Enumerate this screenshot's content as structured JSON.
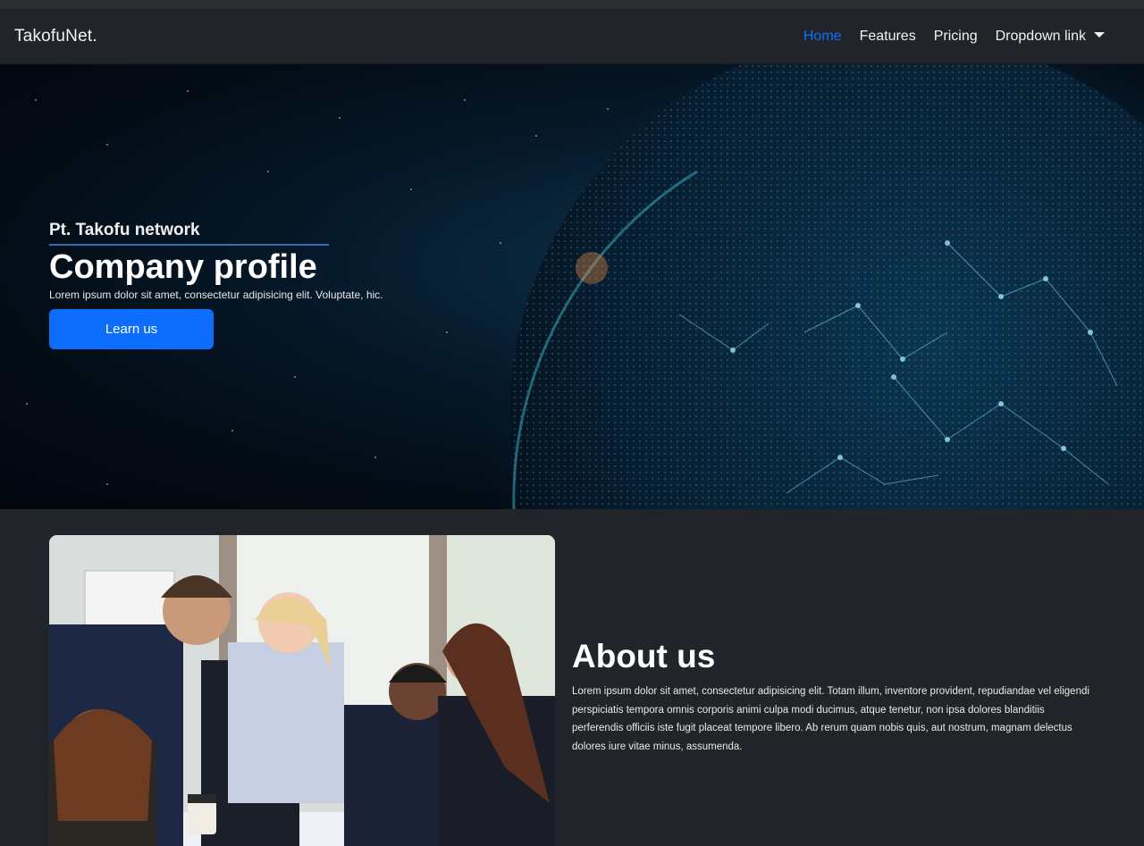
{
  "navbar": {
    "brand": "TakofuNet.",
    "links": [
      {
        "label": "Home",
        "active": true
      },
      {
        "label": "Features",
        "active": false
      },
      {
        "label": "Pricing",
        "active": false
      },
      {
        "label": "Dropdown link",
        "active": false,
        "dropdown": true
      }
    ]
  },
  "hero": {
    "subtitle": "Pt. Takofu network",
    "title": "Company profile",
    "text": "Lorem ipsum dolor sit amet, consectetur adipisicing elit. Voluptate, hic.",
    "button_label": "Learn us",
    "background": "earth-network-globe-image"
  },
  "about": {
    "title": "About us",
    "body": "Lorem ipsum dolor sit amet, consectetur adipisicing elit. Totam illum, inventore provident, repudiandae vel eligendi perspiciatis tempora omnis corporis animi culpa modi ducimus, atque tenetur, non ipsa dolores blanditiis perferendis officiis iste fugit placeat tempore libero. Ab rerum quam nobis quis, aut nostrum, magnam delectus dolores iure vitae minus, assumenda.",
    "image": "team-meeting-photo"
  },
  "colors": {
    "accent": "#0d6efd",
    "background": "#212529"
  }
}
